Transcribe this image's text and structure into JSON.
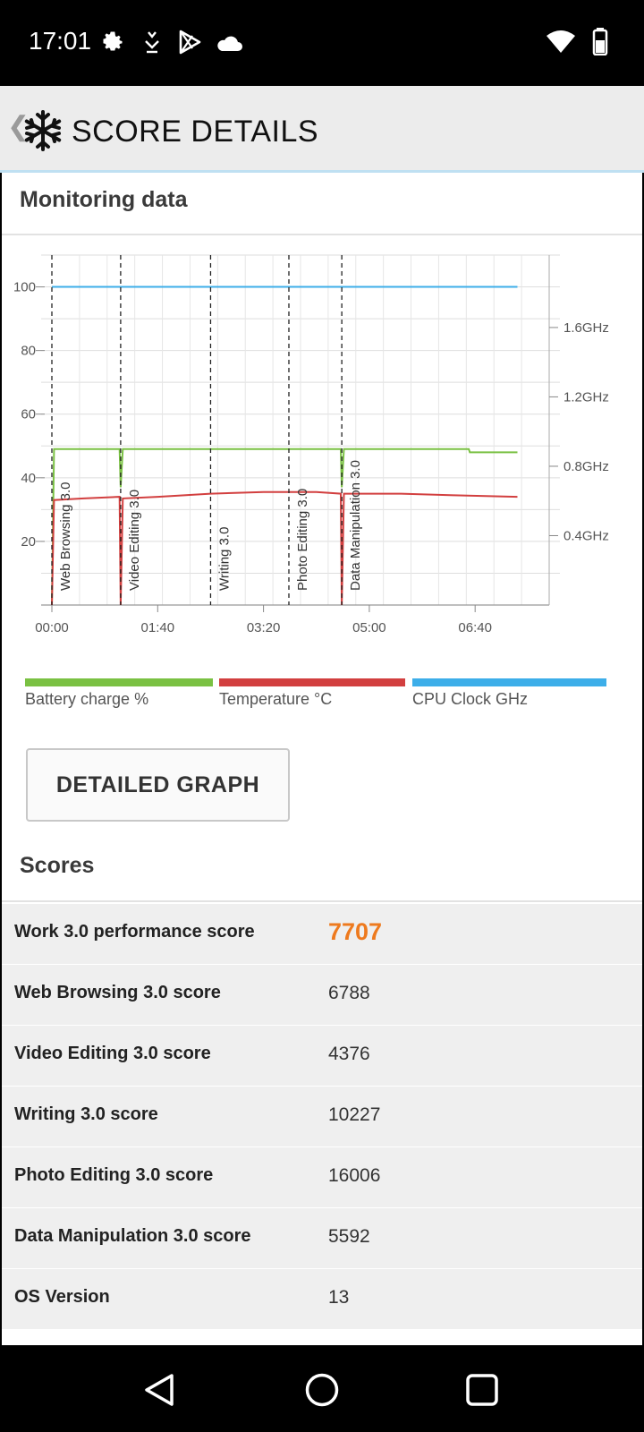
{
  "status_bar": {
    "time": "17:01",
    "icons": [
      "gear-icon",
      "download-icon",
      "play-store-icon",
      "cloud-icon",
      "wifi-icon",
      "battery-icon"
    ]
  },
  "app_bar": {
    "title": "SCORE DETAILS",
    "back_glyph": "❮",
    "logo_icon": "snowflake-icon"
  },
  "monitoring": {
    "title": "Monitoring data",
    "legend": [
      {
        "label": "Battery charge %",
        "color": "#7ac143"
      },
      {
        "label": "Temperature °C",
        "color": "#d23f3f"
      },
      {
        "label": "CPU Clock GHz",
        "color": "#3daee9"
      }
    ],
    "button_label": "DETAILED GRAPH"
  },
  "chart_data": {
    "type": "line",
    "x_unit": "elapsed mm:ss",
    "x_range_sec": [
      0,
      470
    ],
    "x_ticks": [
      {
        "sec": 0,
        "label": "00:00"
      },
      {
        "sec": 100,
        "label": "01:40"
      },
      {
        "sec": 200,
        "label": "03:20"
      },
      {
        "sec": 300,
        "label": "05:00"
      },
      {
        "sec": 400,
        "label": "06:40"
      }
    ],
    "y_left": {
      "range": [
        0,
        110
      ],
      "ticks": [
        20,
        40,
        60,
        80,
        100
      ]
    },
    "y_right": {
      "range_ghz": [
        0,
        2.0175
      ],
      "ticks": [
        {
          "value": 0.4,
          "label": "0.4GHz"
        },
        {
          "value": 0.8,
          "label": "0.8GHz"
        },
        {
          "value": 1.2,
          "label": "1.2GHz"
        },
        {
          "value": 1.6,
          "label": "1.6GHz"
        }
      ]
    },
    "markers": [
      {
        "sec": 0,
        "label": "Web Browsing 3.0"
      },
      {
        "sec": 65,
        "label": "Video Editing 3.0"
      },
      {
        "sec": 150,
        "label": "Writing 3.0"
      },
      {
        "sec": 224,
        "label": "Photo Editing 3.0"
      },
      {
        "sec": 274,
        "label": "Data Manipulation 3.0"
      }
    ],
    "series": [
      {
        "name": "Battery charge %",
        "color": "#7ac143",
        "axis": "left",
        "points": [
          [
            0,
            0
          ],
          [
            2,
            49
          ],
          [
            64,
            49
          ],
          [
            65,
            37
          ],
          [
            67,
            49
          ],
          [
            273,
            49
          ],
          [
            274,
            37
          ],
          [
            276,
            49
          ],
          [
            394,
            49
          ],
          [
            395,
            48
          ],
          [
            440,
            48
          ]
        ]
      },
      {
        "name": "Temperature °C",
        "color": "#d23f3f",
        "axis": "left",
        "points": [
          [
            0,
            0
          ],
          [
            2,
            33
          ],
          [
            30,
            33.5
          ],
          [
            64,
            34
          ],
          [
            65,
            0
          ],
          [
            67,
            33.5
          ],
          [
            100,
            34
          ],
          [
            150,
            35
          ],
          [
            200,
            35.5
          ],
          [
            250,
            35.5
          ],
          [
            273,
            35
          ],
          [
            274,
            0
          ],
          [
            276,
            35
          ],
          [
            330,
            35
          ],
          [
            380,
            34.5
          ],
          [
            440,
            34
          ]
        ]
      },
      {
        "name": "CPU Clock GHz",
        "color": "#3daee9",
        "axis": "left",
        "points": [
          [
            0,
            100
          ],
          [
            440,
            100
          ]
        ]
      }
    ]
  },
  "scores": {
    "title": "Scores",
    "rows": [
      {
        "label": "Work 3.0 performance score",
        "value": "7707",
        "highlight": true
      },
      {
        "label": "Web Browsing 3.0 score",
        "value": "6788"
      },
      {
        "label": "Video Editing 3.0 score",
        "value": "4376"
      },
      {
        "label": "Writing 3.0 score",
        "value": "10227"
      },
      {
        "label": "Photo Editing 3.0 score",
        "value": "16006"
      },
      {
        "label": "Data Manipulation 3.0 score",
        "value": "5592"
      },
      {
        "label": "OS Version",
        "value": "13"
      }
    ]
  },
  "nav_bar": {
    "icons": [
      "back-triangle-icon",
      "home-circle-icon",
      "recents-square-icon"
    ]
  }
}
